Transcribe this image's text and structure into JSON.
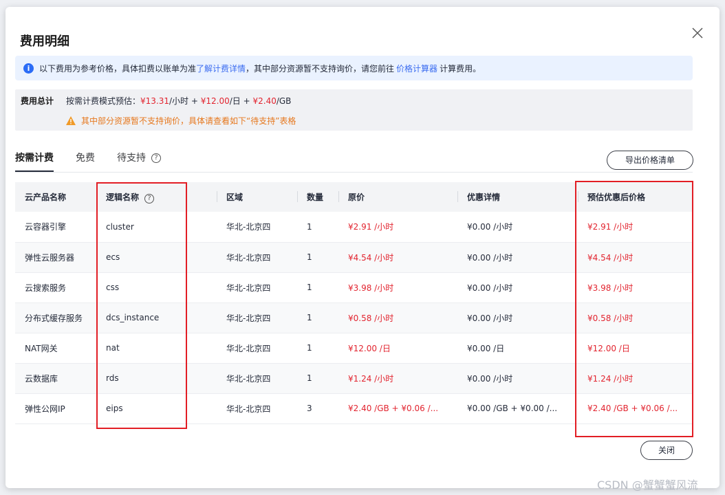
{
  "dialog": {
    "title": "费用明细",
    "close_icon": "close-icon"
  },
  "info": {
    "icon": "info-icon",
    "text_before_link1": "以下费用为参考价格，具体扣费以账单为准",
    "link1": "了解计费详情",
    "text_middle": "，其中部分资源暂不支持询价，请您前往",
    "link2": "价格计算器",
    "text_after": "计算费用。"
  },
  "summary": {
    "label": "费用总计",
    "prefix": "按需计费模式预估：",
    "hourly": "¥13.31",
    "hourly_unit": "/小时 + ",
    "daily": "¥12.00",
    "daily_unit": "/日 + ",
    "per_gb": "¥2.40",
    "per_gb_unit": "/GB",
    "warning_icon": "warning-icon",
    "warning": "其中部分资源暂不支持询价，具体请查看如下“待支持”表格"
  },
  "tabs": [
    {
      "label": "按需计费",
      "active": true
    },
    {
      "label": "免费",
      "active": false
    },
    {
      "label": "待支持",
      "active": false,
      "help_icon": "?"
    }
  ],
  "export_label": "导出价格清单",
  "table": {
    "headers": [
      "云产品名称",
      "逻辑名称",
      "区域",
      "数量",
      "原价",
      "优惠详情",
      "预估优惠后价格"
    ],
    "header_help_icon": "?",
    "rows": [
      [
        "云容器引擎",
        "cluster",
        "华北-北京四",
        "1",
        "¥2.91 /小时",
        "¥0.00 /小时",
        "¥2.91 /小时"
      ],
      [
        "弹性云服务器",
        "ecs",
        "华北-北京四",
        "1",
        "¥4.54 /小时",
        "¥0.00 /小时",
        "¥4.54 /小时"
      ],
      [
        "云搜索服务",
        "css",
        "华北-北京四",
        "1",
        "¥3.98 /小时",
        "¥0.00 /小时",
        "¥3.98 /小时"
      ],
      [
        "分布式缓存服务",
        "dcs_instance",
        "华北-北京四",
        "1",
        "¥0.58 /小时",
        "¥0.00 /小时",
        "¥0.58 /小时"
      ],
      [
        "NAT网关",
        "nat",
        "华北-北京四",
        "1",
        "¥12.00 /日",
        "¥0.00 /日",
        "¥12.00 /日"
      ],
      [
        "云数据库",
        "rds",
        "华北-北京四",
        "1",
        "¥1.24 /小时",
        "¥0.00 /小时",
        "¥1.24 /小时"
      ],
      [
        "弹性公网IP",
        "eips",
        "华北-北京四",
        "3",
        "¥2.40 /GB + ¥0.06 /...",
        "¥0.00 /GB + ¥0.00 /...",
        "¥2.40 /GB + ¥0.06 /..."
      ]
    ]
  },
  "close_label": "关闭",
  "watermark": "CSDN @蟹蟹蟹风流",
  "colors": {
    "accent": "#3b6cf0",
    "price_red": "#e2242f",
    "warning_orange": "#e6781e",
    "annotation_red": "#e21d24"
  }
}
